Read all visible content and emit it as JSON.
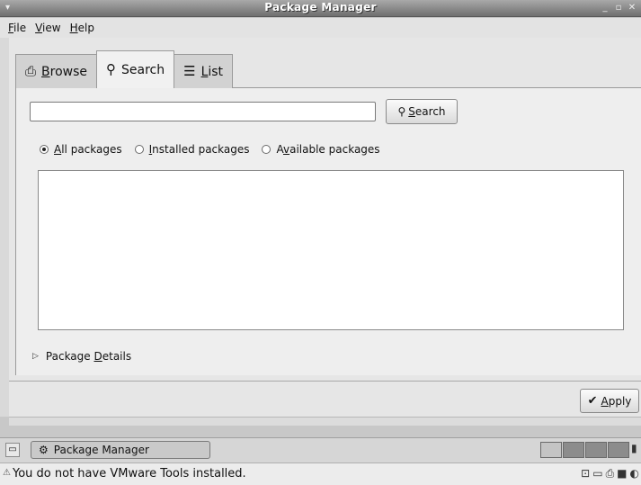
{
  "window": {
    "title": "Package Manager"
  },
  "menu": {
    "file": {
      "accel": "F",
      "rest": "ile"
    },
    "view": {
      "accel": "V",
      "rest": "iew"
    },
    "help": {
      "accel": "H",
      "rest": "elp"
    }
  },
  "tabs": [
    {
      "accel": "B",
      "rest": "rowse",
      "icon": "browse-icon",
      "active": false
    },
    {
      "accel": "",
      "rest": "Search",
      "icon": "magnifier-icon",
      "active": true
    },
    {
      "accel": "L",
      "rest": "ist",
      "icon": "list-icon",
      "active": false
    }
  ],
  "search": {
    "input_value": "",
    "button_accel": "S",
    "button_rest": "earch"
  },
  "filters": [
    {
      "accel": "A",
      "rest": "ll packages",
      "checked": true
    },
    {
      "accel": "I",
      "rest": "nstalled packages",
      "checked": false
    },
    {
      "pre": "A",
      "accel": "v",
      "rest": "ailable packages",
      "checked": false
    }
  ],
  "details": {
    "pre": "Package ",
    "accel": "D",
    "rest": "etails"
  },
  "apply": {
    "accel": "A",
    "rest": "pply"
  },
  "taskbar": {
    "task_label": "Package Manager"
  },
  "statusbar": {
    "message": "You do not have VMware Tools installed."
  }
}
